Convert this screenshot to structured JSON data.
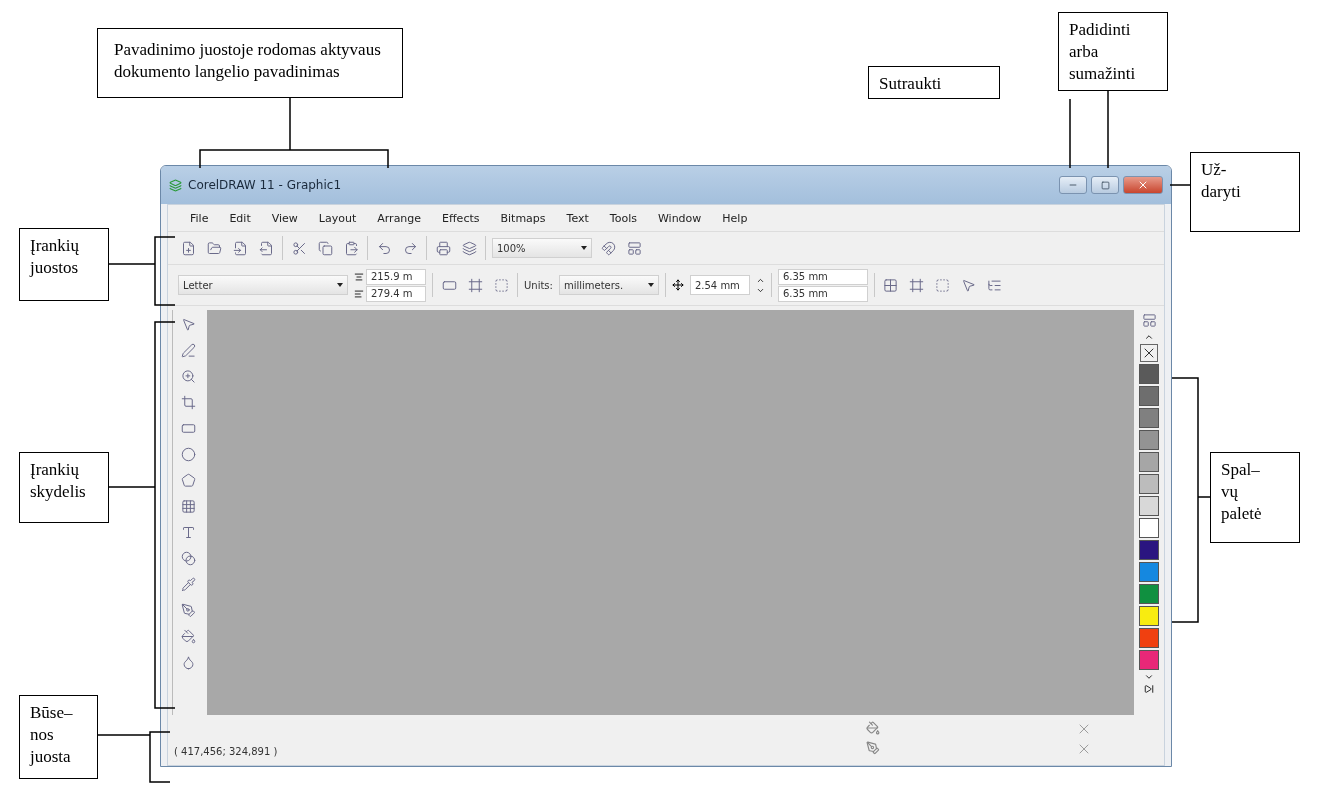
{
  "window": {
    "title": "CorelDRAW 11 - Graphic1"
  },
  "menu": [
    "File",
    "Edit",
    "View",
    "Layout",
    "Arrange",
    "Effects",
    "Bitmaps",
    "Text",
    "Tools",
    "Window",
    "Help"
  ],
  "toolbar": {
    "zoom": "100%"
  },
  "property_bar": {
    "paper": "Letter",
    "width": "215.9 m",
    "height": "279.4 m",
    "units_label": "Units:",
    "units": "millimeters.",
    "nudge": "2.54 mm",
    "duplicate_x": "6.35 mm",
    "duplicate_y": "6.35 mm"
  },
  "palette": [
    {
      "color": "#5a5a5a"
    },
    {
      "color": "#6e6e6e"
    },
    {
      "color": "#808080"
    },
    {
      "color": "#939393"
    },
    {
      "color": "#a6a6a6"
    },
    {
      "color": "#bcbcbc"
    },
    {
      "color": "#d8d8d8"
    },
    {
      "color": "#ffffff"
    },
    {
      "color": "#2a1580"
    },
    {
      "color": "#1588e0"
    },
    {
      "color": "#109040"
    },
    {
      "color": "#f8ec10"
    },
    {
      "color": "#f04010"
    },
    {
      "color": "#e82878"
    }
  ],
  "status_bar": {
    "coordinates": "( 417,456; 324,891 )"
  },
  "callouts": [
    {
      "lines": [
        "Pavadinimo juostoje rodomas aktyvaus",
        "dokumento langelio pavadinimas"
      ]
    },
    {
      "lines": [
        "Sutraukti"
      ]
    },
    {
      "lines": [
        "Padidinti",
        "arba",
        "sumažinti"
      ]
    },
    {
      "lines": [
        "Už-",
        "daryti"
      ]
    },
    {
      "lines": [
        "Įrankių",
        "juostos"
      ]
    },
    {
      "lines": [
        "Įrankių",
        "skydelis"
      ]
    },
    {
      "lines": [
        "Spal–",
        "vų",
        "paletė"
      ]
    },
    {
      "lines": [
        "Būse–",
        "nos",
        "juosta"
      ]
    }
  ]
}
